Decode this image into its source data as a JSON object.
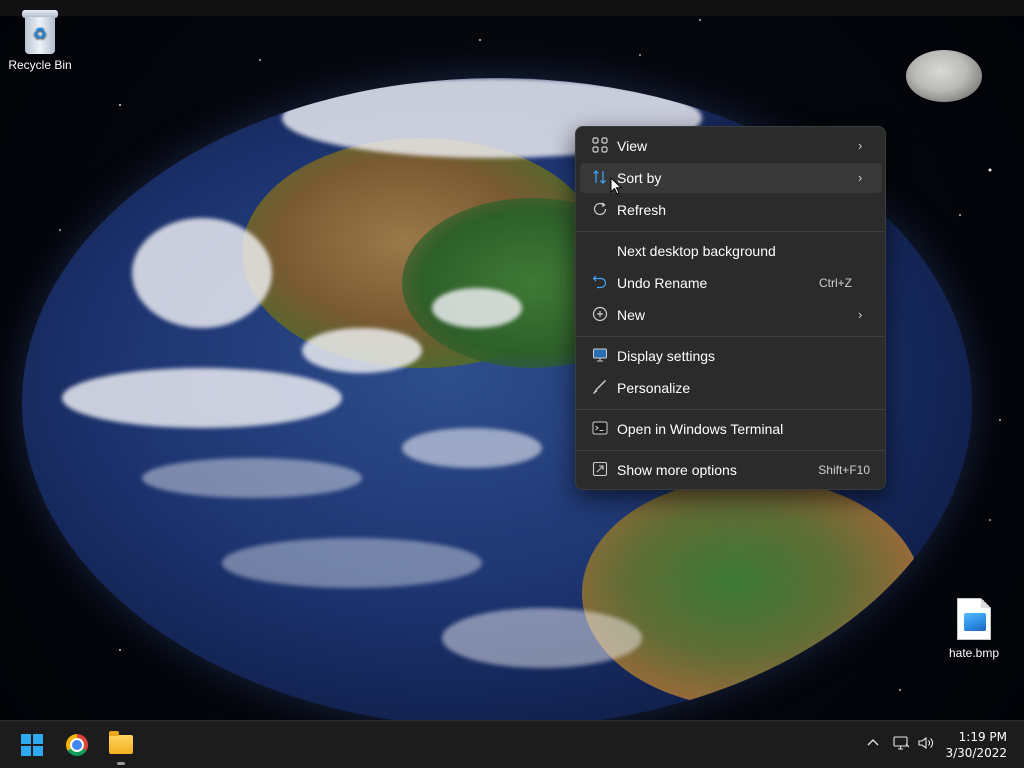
{
  "desktop": {
    "icons": [
      {
        "label": "Recycle Bin",
        "icon": "recycle-bin-icon"
      },
      {
        "label": "hate.bmp",
        "icon": "image-file-icon"
      }
    ]
  },
  "context_menu": {
    "items": [
      {
        "label": "View",
        "icon": "grid-icon",
        "has_submenu": true
      },
      {
        "label": "Sort by",
        "icon": "sort-icon",
        "has_submenu": true
      },
      {
        "label": "Refresh",
        "icon": "refresh-icon"
      },
      {
        "label": "Next desktop background"
      },
      {
        "label": "Undo Rename",
        "icon": "undo-icon",
        "shortcut": "Ctrl+Z"
      },
      {
        "label": "New",
        "icon": "plus-circle-icon",
        "has_submenu": true
      },
      {
        "label": "Display settings",
        "icon": "display-icon"
      },
      {
        "label": "Personalize",
        "icon": "brush-icon"
      },
      {
        "label": "Open in Windows Terminal",
        "icon": "terminal-icon"
      },
      {
        "label": "Show more options",
        "icon": "more-options-icon",
        "shortcut": "Shift+F10"
      }
    ]
  },
  "taskbar": {
    "apps": [
      "start-icon",
      "chrome-icon",
      "file-explorer-icon"
    ],
    "tray": {
      "icons": [
        "chevron-up-icon",
        "network-icon",
        "volume-icon"
      ],
      "time": "1:19 PM",
      "date": "3/30/2022"
    }
  },
  "colors": {
    "menu_bg": "#2b2b2b",
    "taskbar_bg": "#1c1c1c",
    "accent": "#2fa8f2"
  }
}
